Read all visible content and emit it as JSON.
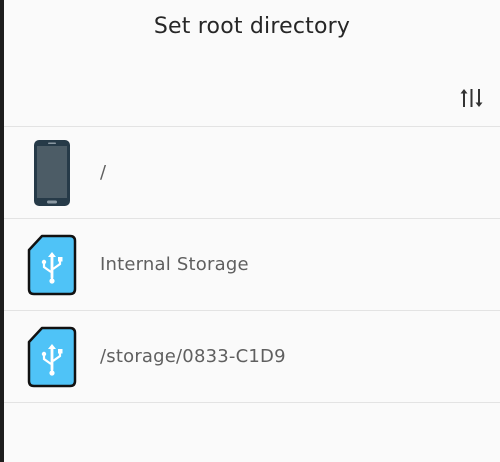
{
  "dialog": {
    "title": "Set root directory"
  },
  "toolbar": {
    "sort_icon": "sort-icon"
  },
  "entries": [
    {
      "label": "/",
      "icon": "phone-icon"
    },
    {
      "label": "Internal Storage",
      "icon": "usb-storage-icon"
    },
    {
      "label": "/storage/0833-C1D9",
      "icon": "usb-storage-icon"
    }
  ],
  "colors": {
    "background": "#fafafa",
    "title_text": "#262626",
    "label_text": "#5f5f5f",
    "divider": "#e3e3e3",
    "storage_icon_fill": "#4fc3f7",
    "phone_body": "#263a48",
    "phone_screen": "#4c5c66"
  }
}
